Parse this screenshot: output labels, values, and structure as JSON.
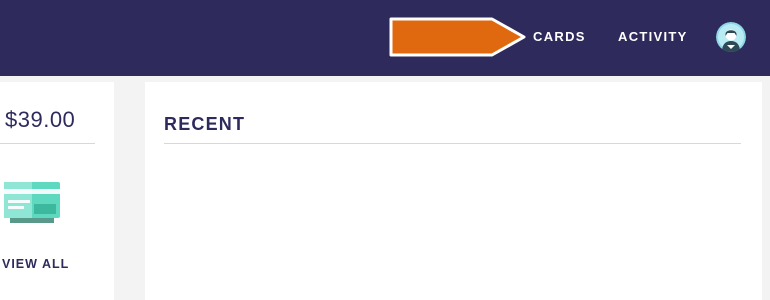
{
  "nav": {
    "cards_label": "CARDS",
    "activity_label": "ACTIVITY"
  },
  "icons": {
    "avatar": "user-avatar-icon",
    "pointer": "arrow-pointer-icon",
    "card": "credit-card-icon"
  },
  "summary": {
    "balance": "$39.00",
    "view_all_label": "VIEW ALL"
  },
  "recent": {
    "title": "RECENT"
  },
  "colors": {
    "header_bg": "#2e2b5c",
    "accent_orange": "#e0690f",
    "card_teal": "#5fd8c0",
    "text_navy": "#2e2b5c",
    "page_bg": "#f3f3f4"
  }
}
